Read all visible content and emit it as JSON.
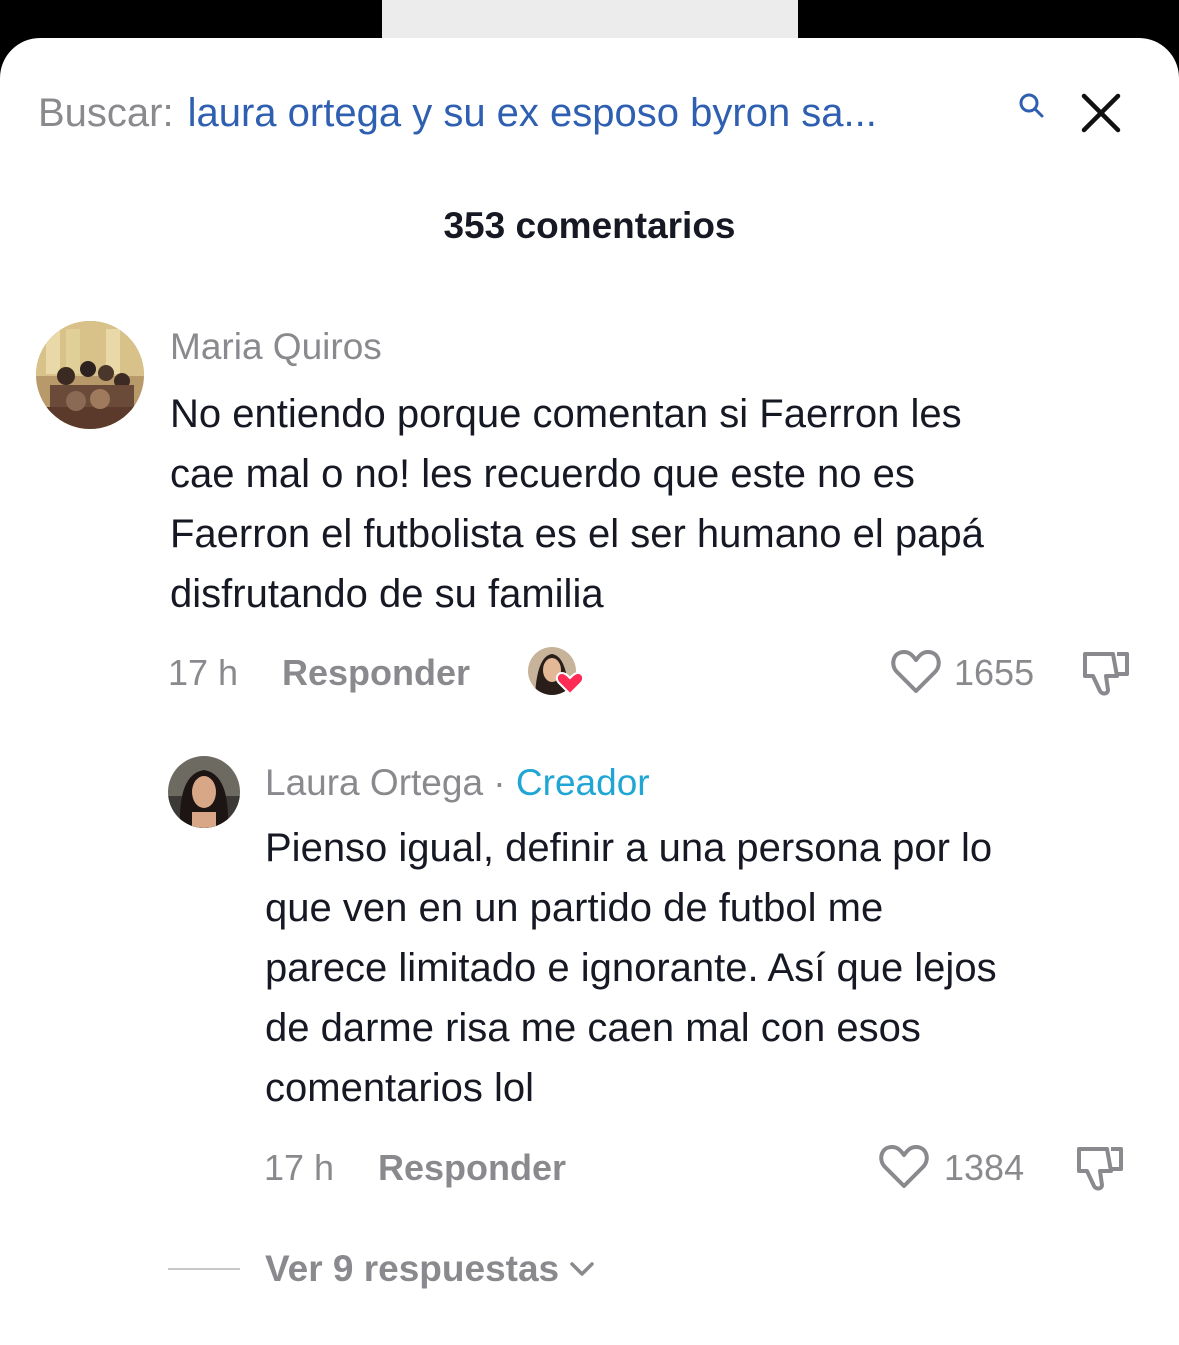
{
  "search": {
    "prefix": "Buscar:",
    "query": "laura ortega y su ex esposo byron sa..."
  },
  "comments_header": {
    "count_label": "353 comentarios"
  },
  "comment": {
    "username": "Maria Quiros",
    "lines": [
      "No entiendo porque comentan si Faerron les",
      "cae mal o no! les recuerdo que este no es",
      "Faerron el futbolista es el ser humano el papá",
      "disfrutando de su familia"
    ],
    "time": "17 h",
    "reply_label": "Responder",
    "likes": "1655"
  },
  "reply": {
    "username": "Laura Ortega",
    "separator": " · ",
    "creator_label": "Creador",
    "lines": [
      "Pienso igual, definir a una persona por lo",
      "que ven en un partido de futbol me",
      "parece limitado e ignorante. Así que lejos",
      "de darme risa me caen mal con esos",
      "comentarios lol"
    ],
    "time": "17 h",
    "reply_label": "Responder",
    "likes": "1384"
  },
  "view_replies": {
    "label": "Ver 9 respuestas"
  },
  "colors": {
    "search_query": "#2e5fb0",
    "creator_tag": "#20a6d4",
    "muted_text": "#8a8a8e",
    "body_text": "#161823",
    "creator_like_heart": "#fe2c55"
  },
  "icons": [
    "search-icon",
    "close-icon",
    "heart-icon",
    "dislike-icon",
    "creator-liked-badge",
    "chevron-down-icon"
  ]
}
